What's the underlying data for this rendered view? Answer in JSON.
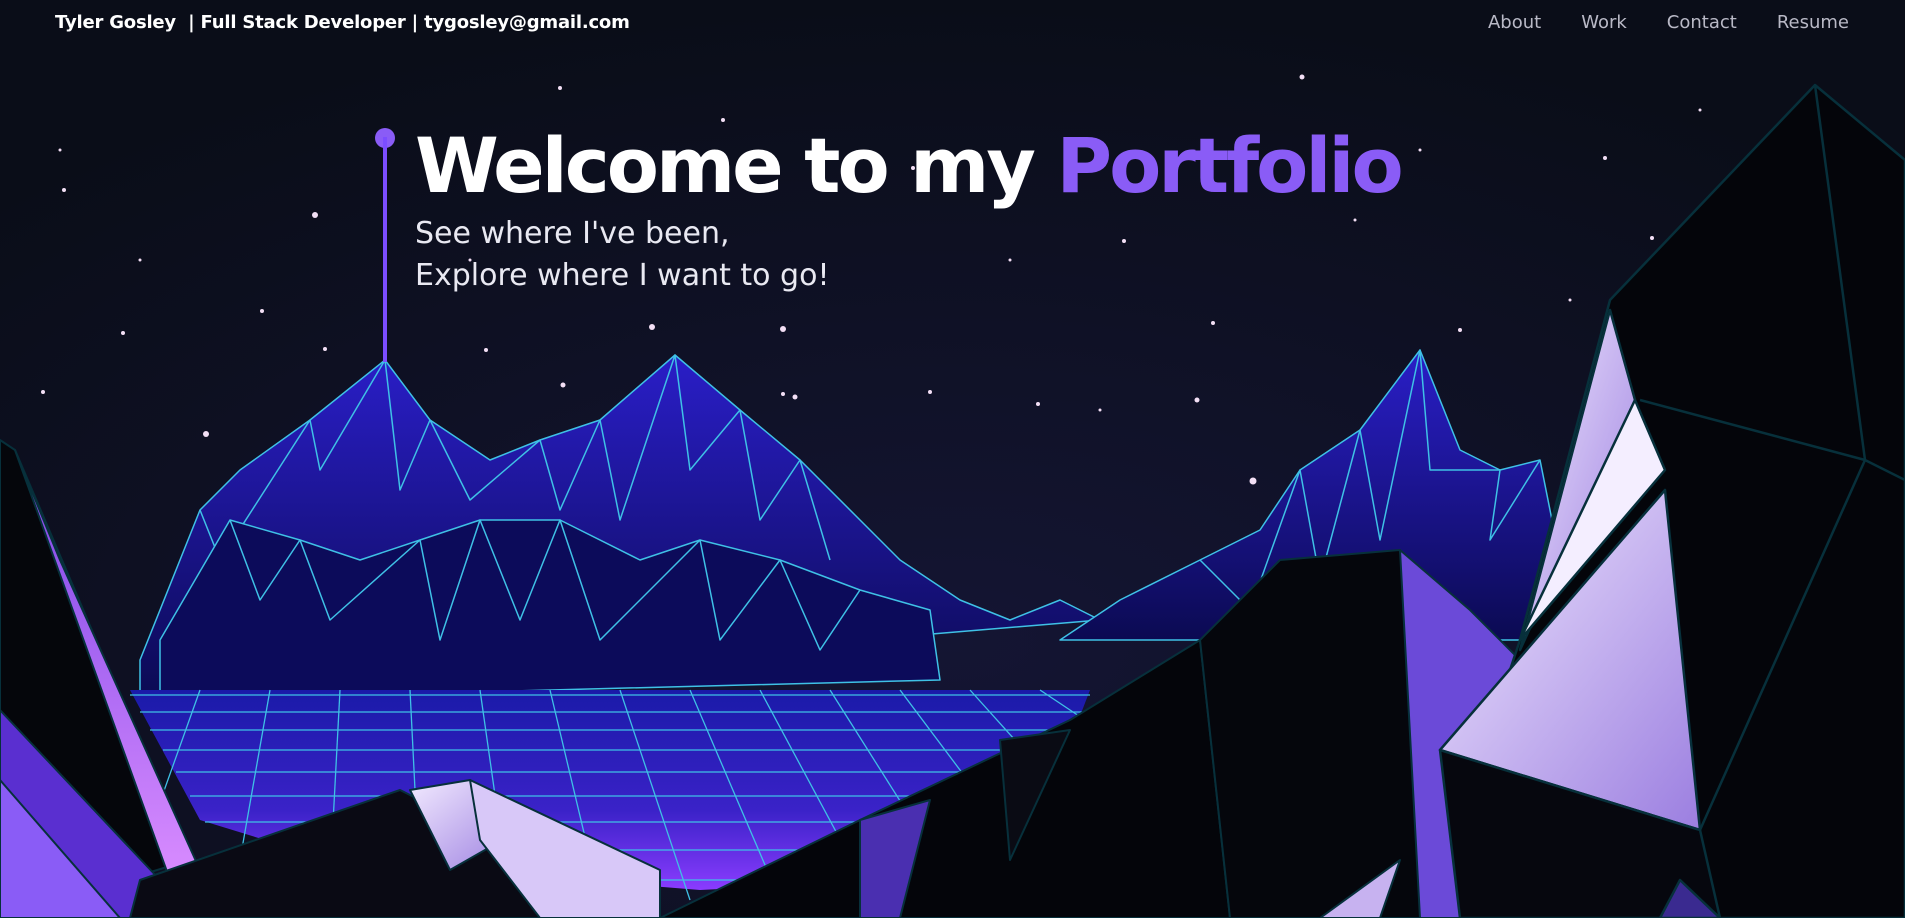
{
  "header": {
    "brand": "Tyler Gosley  | Full Stack Developer | tygosley@gmail.com",
    "nav": [
      "About",
      "Work",
      "Contact",
      "Resume"
    ]
  },
  "hero": {
    "title_part1": "Welcome to my ",
    "title_accent": "Portfolio",
    "subtitle_line1": "See where I've been,",
    "subtitle_line2": "Explore where I want to go!"
  },
  "colors": {
    "background": "#0a0d18",
    "accent": "#8a5cf6",
    "grid_line": "#3fc1e6"
  }
}
